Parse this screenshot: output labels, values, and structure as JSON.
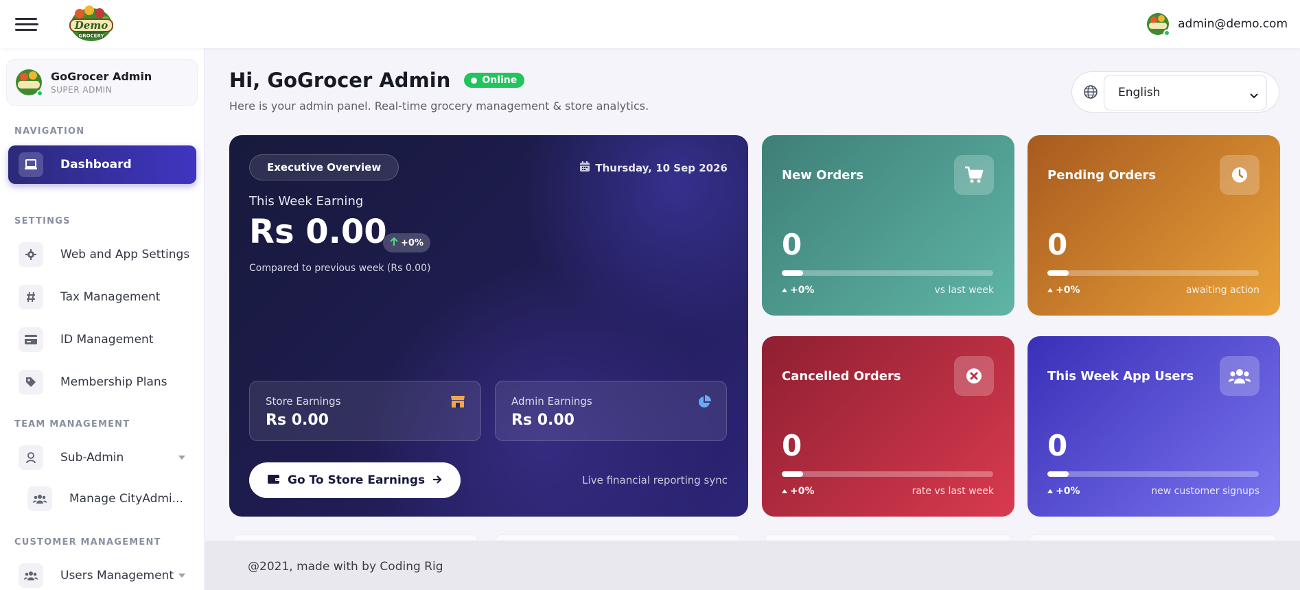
{
  "header": {
    "menu_icon": "hamburger-menu-icon",
    "logo_text_top": "Demo",
    "logo_text_bottom": "GROCERY",
    "user_email": "admin@demo.com"
  },
  "sidebar": {
    "profile": {
      "name": "GoGrocer Admin",
      "role": "SUPER ADMIN"
    },
    "sections": {
      "navigation": "NAVIGATION",
      "settings": "SETTINGS",
      "team": "TEAM MANAGEMENT",
      "customer": "CUSTOMER MANAGEMENT"
    },
    "items": [
      {
        "label": "Dashboard",
        "icon": "laptop-icon",
        "active": true
      },
      {
        "label": "Web and App Settings",
        "icon": "gear-icon"
      },
      {
        "label": "Tax Management",
        "icon": "hash-icon"
      },
      {
        "label": "ID Management",
        "icon": "id-card-icon"
      },
      {
        "label": "Membership Plans",
        "icon": "tag-icon"
      },
      {
        "label": "Sub-Admin",
        "icon": "user-tie-icon",
        "has_dropdown": true
      },
      {
        "label": "Manage CityAdmi...",
        "icon": "users-icon"
      },
      {
        "label": "Users Management",
        "icon": "users-icon",
        "has_dropdown": true
      }
    ]
  },
  "main": {
    "greeting": "Hi, GoGrocer Admin",
    "status": "Online",
    "subtitle": "Here is your admin panel. Real-time grocery management & store analytics.",
    "language": {
      "selected": "English",
      "icon": "globe-icon"
    }
  },
  "executive": {
    "pill": "Executive Overview",
    "date": "Thursday, 10 Sep 2026",
    "label": "This Week Earning",
    "amount": "Rs 0.00",
    "change": "+0%",
    "compare": "Compared to previous week (Rs 0.00)",
    "store_earnings": {
      "label": "Store Earnings",
      "value": "Rs 0.00",
      "icon": "store-icon"
    },
    "admin_earnings": {
      "label": "Admin Earnings",
      "value": "Rs 0.00",
      "icon": "pie-chart-icon"
    },
    "button": "Go To Store Earnings",
    "sync_note": "Live financial reporting sync"
  },
  "stats": [
    {
      "title": "New Orders",
      "value": "0",
      "change": "+0%",
      "note": "vs last week",
      "icon": "cart-icon",
      "progress": 0.1,
      "color_from": "#3e7f77",
      "color_to": "#5fb5a6"
    },
    {
      "title": "Pending Orders",
      "value": "0",
      "change": "+0%",
      "note": "awaiting action",
      "icon": "clock-icon",
      "progress": 0.1,
      "color_from": "#a85a1e",
      "color_to": "#eaa23a"
    },
    {
      "title": "Cancelled Orders",
      "value": "0",
      "change": "+0%",
      "note": "rate vs last week",
      "icon": "x-circle-icon",
      "progress": 0.1,
      "color_from": "#8f1f31",
      "color_to": "#d93a4f"
    },
    {
      "title": "This Week App Users",
      "value": "0",
      "change": "+0%",
      "note": "new customer signups",
      "icon": "users-icon",
      "progress": 0.1,
      "color_from": "#3a2fb8",
      "color_to": "#7a74ef"
    }
  ],
  "footer": {
    "text": "@2021, made with by Coding Rig"
  }
}
